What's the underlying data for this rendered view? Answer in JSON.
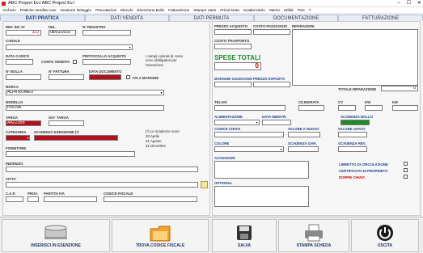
{
  "window": {
    "title": "ABC Project Ev.I ABC Project Ev.I",
    "min": "–",
    "max": "☐",
    "close": "✕"
  },
  "menu": [
    "Archivio",
    "Pratiche Vendita Auto",
    "Gestione Noleggio",
    "Prenotazioni",
    "Elenchi",
    "Esenzione Bollo",
    "Fatturazione",
    "Stampe Varie",
    "Prima Nota",
    "Scadenziario",
    "Memo",
    "Utilità",
    "Fine",
    "?"
  ],
  "tabs": [
    "DATI PRATICA",
    "DATI VENDITA",
    "DATI PERMUTA",
    "DOCUMENTAZIONE",
    "FATTURAZIONE"
  ],
  "left": {
    "ref_int_label": "REF. INT. N°",
    "ref_int_value": "323",
    "del_label": "DEL",
    "del_value": "08/01/2019",
    "registro_label": "N° REGISTRO",
    "canale_label": "CANALE",
    "data_carico_label": "DATA CARICO",
    "conto_vendita_label": "CONTO VENDITA",
    "protocollo_label": "PROTOCOLLO ACQUISTO",
    "required_note": "I campi colorati di rosso sono obbligatori per l'esenzione.",
    "n_bolla_label": "N° BOLLA",
    "n_fattura_label": "N° FATTURA",
    "data_documento_label": "DATA DOCUMENTO",
    "iva_margine_label": "IVA A MARGINE",
    "marca_label": "MARCA",
    "marca_value": "ALFA ROMEO",
    "modello_label": "MODELLO",
    "modello_value": "PROVA",
    "targa_label": "TARGA",
    "targa_value": "AA222BB",
    "gia_targa_label": "GIA' TARGA",
    "categoria_label": "CATEGORIA",
    "scadenza_label": "SCADENZA ESENZIONE (*)",
    "scadenze_note_title": "(*) Le scadenze sono:",
    "scadenze_dates": [
      "30 Aprile",
      "31 Agosto",
      "31 Dicembre"
    ],
    "fornitore_label": "FORNITORE",
    "indirizzo_label": "INDIRIZZO",
    "citta_label": "CITTA'",
    "cap_label": "C.A.P.",
    "prov_label": "PROV.",
    "piva_label": "PARTITA IVA",
    "cf_label": "CODICE FISCALE"
  },
  "right": {
    "prezzo_acquisto_label": "PREZZO ACQUISTO",
    "costo_passaggio_label": "COSTO PASSAGGIO",
    "riparazioni_label": "RIPARAZIONI",
    "costo_trasporto_label": "COSTO TRASPORTO",
    "spese_totali_label": "SPESE TOTALI",
    "spese_totali_value": "0",
    "margine_label": "MARGINE GUADAGNO",
    "prezzo_esposto_label": "PREZZO ESPOSTO",
    "totale_riparazione_label": "TOTALE RIPARAZIONE",
    "totale_riparazione_value": "0",
    "telaio_label": "TELAIO",
    "cilindrata_label": "CILINDRATA",
    "cv_label": "CV",
    "kw_label": "KW",
    "km_label": "KM",
    "alimentazione_label": "ALIMENTAZIONE",
    "data_immatr_label": "DATA IMMATR.",
    "scadenza_bollo_label": "SCADENZA BOLLO",
    "codice_chiavi_label": "CODICE CHIAVI",
    "valore_nuovo_label": "VALORE A NUOVO",
    "valore_usato_label": "VALORE USATO",
    "colore_label": "COLORE",
    "scadenza_gar_label": "SCADENZA GAR.",
    "scadenza_rev_label": "SCADENZA REV.",
    "accessori_label": "ACCESSORI",
    "libretto_label": "LIBRETTO DI CIRCOLAZIONE",
    "certificato_label": "CERTIFICATO DI PROPRIETA'",
    "doppie_chiavi_label": "DOPPIE CHIAVI",
    "optional_label": "OPTIONAL",
    "colors": {
      "required": "#b30f1d",
      "green": "#1f8a2c",
      "blue_label": "#1c3f8a",
      "red_label": "#c20000"
    }
  },
  "buttons": {
    "inserisci": "INSERISCI IN ESENZIONE",
    "trova": "TROVA CODICE FISCALE",
    "salva": "SALVA",
    "stampa": "STAMPA SCHEDA",
    "uscita": "USCITA"
  }
}
